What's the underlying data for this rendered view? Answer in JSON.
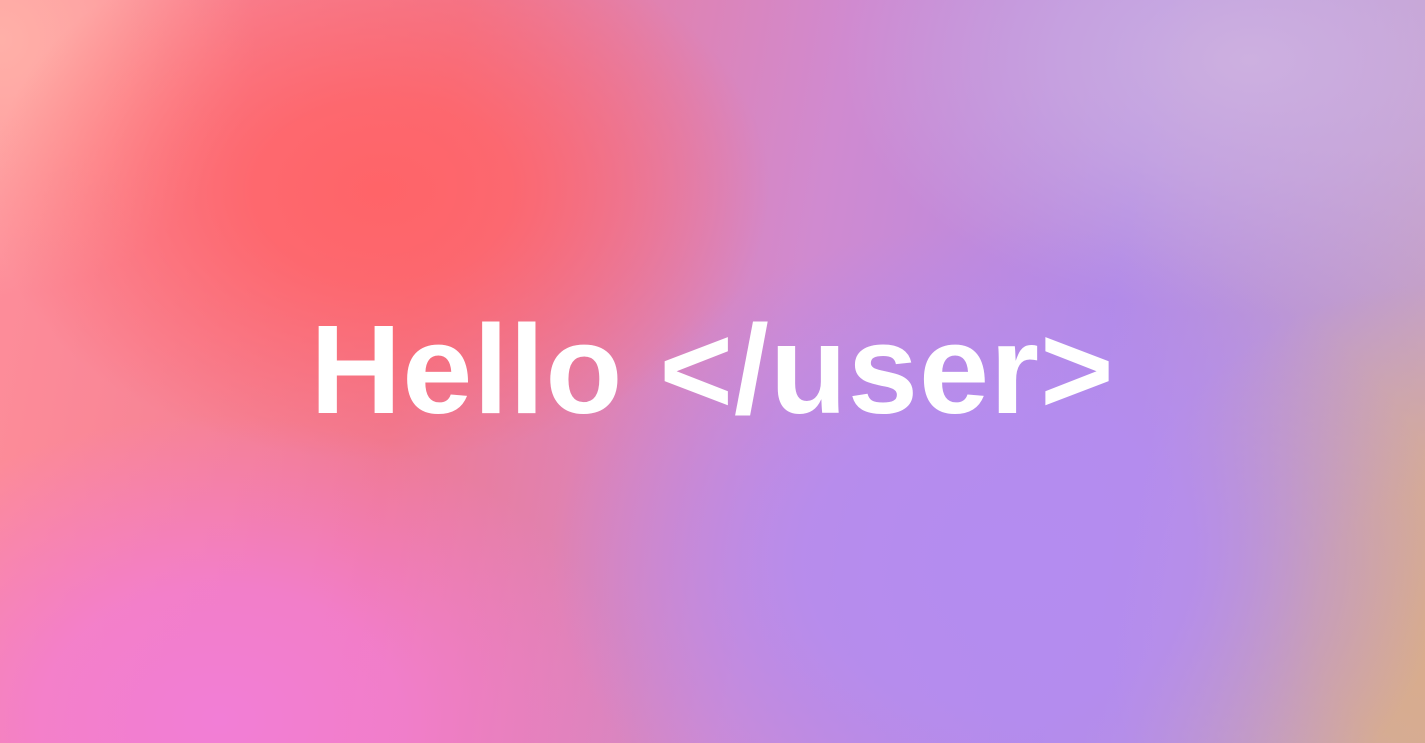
{
  "hero": {
    "headline": "Hello </user>",
    "colors": {
      "text": "#ffffff",
      "coral": "#ff6468",
      "lavender": "#b48cf0",
      "pink": "#f27ed6",
      "sand": "#d9ad8a"
    }
  }
}
